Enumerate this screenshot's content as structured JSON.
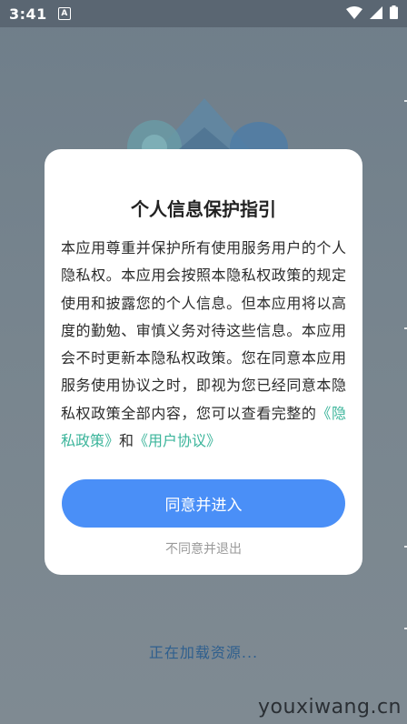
{
  "status_bar": {
    "time": "3:41",
    "notification_glyph": "A",
    "icons": [
      "wifi-icon",
      "cellular-icon",
      "battery-icon"
    ]
  },
  "background": {
    "loading_text": "正在加载资源...",
    "watermark": "youxiwang.cn"
  },
  "dialog": {
    "title": "个人信息保护指引",
    "body_part1": "本应用尊重并保护所有使用服务用户的个人隐私权。本应用会按照本隐私权政策的规定使用和披露您的个人信息。但本应用将以高度的勤勉、审慎义务对待这些信息。本应用会不时更新本隐私权政策。您在同意本应用服务使用协议之时，即视为您已经同意本隐私权政策全部内容，您可以查看完整的",
    "privacy_link": "《隐私政策》",
    "conjunction": "和",
    "user_agreement_link": "《用户协议》",
    "agree_label": "同意并进入",
    "disagree_label": "不同意并退出"
  },
  "colors": {
    "accent": "#4a8ff7",
    "link": "#3cb59b",
    "overlay": "#76838d"
  }
}
